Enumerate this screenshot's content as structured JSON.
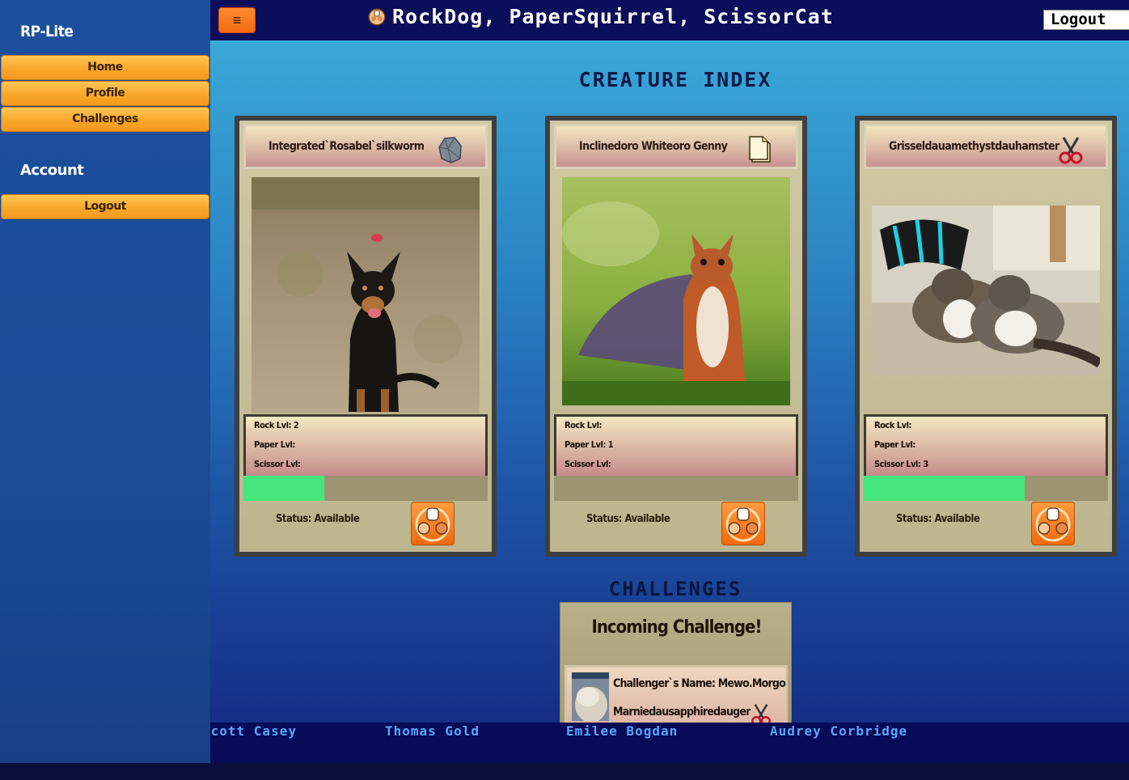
{
  "sidebar": {
    "brand": "RP-Lite",
    "nav": [
      "Home",
      "Profile",
      "Challenges"
    ],
    "account_title": "Account",
    "logout": "Logout"
  },
  "topbar": {
    "menu_icon": "≡",
    "title": "RockDog, PaperSquirrel, ScissorCat",
    "logout": "Logout"
  },
  "main": {
    "index_heading": "CREATURE INDEX",
    "challenges_heading": "CHALLENGES"
  },
  "cards": [
    {
      "name": "Integrated`Rosabel`silkworm",
      "type_icon": "rock-icon",
      "rock": "Rock Lvl: 2",
      "paper": "Paper Lvl:",
      "scissor": "Scissor Lvl:",
      "xp_fraction": 0.33,
      "status": "Status: Available"
    },
    {
      "name": "Inclinedoro Whiteoro Genny",
      "type_icon": "paper-icon",
      "rock": "Rock Lvl:",
      "paper": "Paper Lvl: 1",
      "scissor": "Scissor Lvl:",
      "xp_fraction": 0,
      "status": "Status: Available"
    },
    {
      "name": "Grisseldauamethystdauhamster",
      "type_icon": "scissors-icon",
      "rock": "Rock Lvl:",
      "paper": "Paper Lvl:",
      "scissor": "Scissor Lvl: 3",
      "xp_fraction": 0.66,
      "status": "Status: Available"
    }
  ],
  "challenge": {
    "title": "Incoming Challenge!",
    "challenger": "Challenger`s Name: Mewo.Morgo",
    "creature": "Marniedausapphiredaugerbil"
  },
  "ticker": [
    "Scott Casey",
    "Thomas Gold",
    "Emilee Bogdan",
    "Audrey Corbridge"
  ],
  "colors": {
    "xp": "#46e67e",
    "orange": "#f9a528",
    "topbar": "#0b0e5a"
  }
}
